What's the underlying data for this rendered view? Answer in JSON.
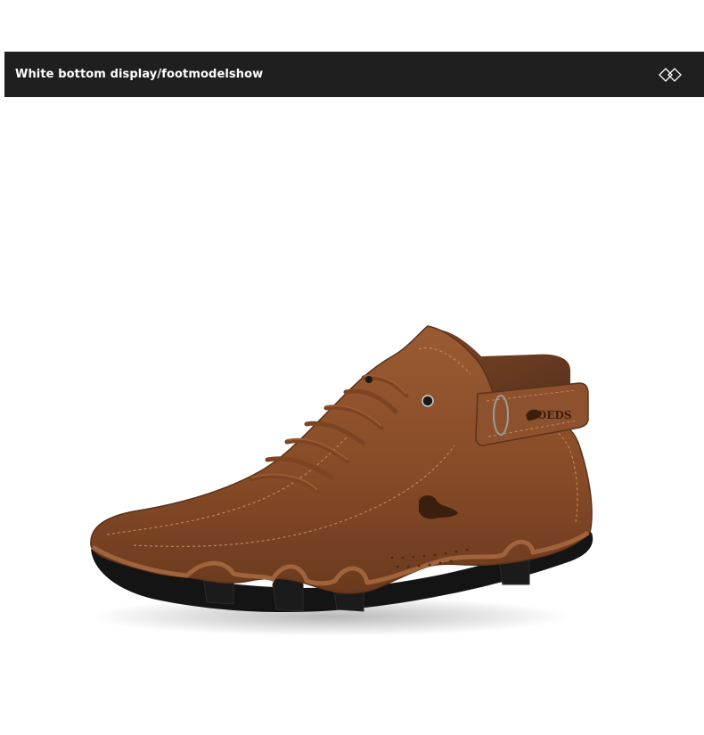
{
  "header": {
    "title": "White bottom display/footmodelshow",
    "icon": "double-diamond-icon"
  },
  "product": {
    "image": "brown-leather-high-top-shoe",
    "logo_text": "LOEDS",
    "colors": {
      "leather": "#8a4f2a",
      "leather_dark": "#5c321a",
      "sole": "#141414",
      "header_bg": "#1f1f1f"
    }
  }
}
